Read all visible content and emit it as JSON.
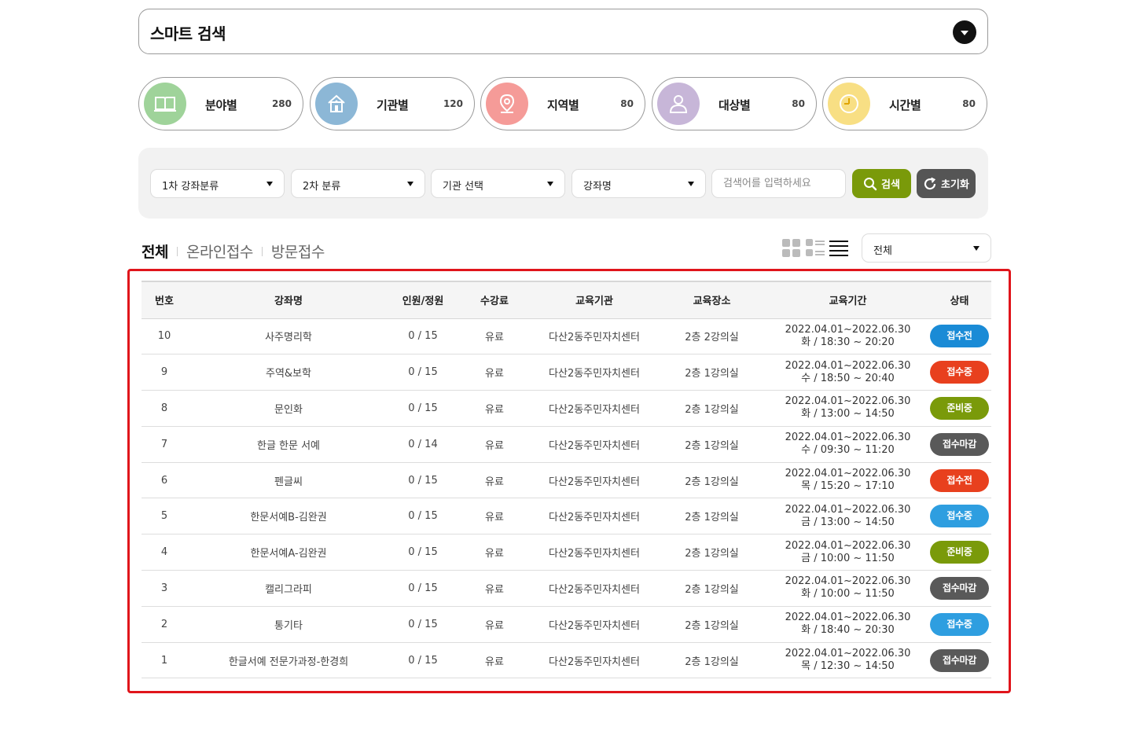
{
  "smart_search": {
    "title": "스마트 검색"
  },
  "categories": [
    {
      "label": "분야별",
      "count": "280",
      "icon": "book-icon",
      "color": "#9fd39a"
    },
    {
      "label": "기관별",
      "count": "120",
      "icon": "house-icon",
      "color": "#8cb7d6"
    },
    {
      "label": "지역별",
      "count": "80",
      "icon": "map-pin-icon",
      "color": "#f59b98"
    },
    {
      "label": "대상별",
      "count": "80",
      "icon": "person-icon",
      "color": "#c7b6d8"
    },
    {
      "label": "시간별",
      "count": "80",
      "icon": "clock-icon",
      "color": "#f8df84"
    }
  ],
  "filters": {
    "category1": "1차 강좌분류",
    "category2": "2차 분류",
    "institution": "기관 선택",
    "course": "강좌명",
    "keyword_placeholder": "검색어를 입력하세요",
    "search_label": "검색",
    "reset_label": "초기화"
  },
  "tabs": [
    {
      "label": "전체",
      "active": true
    },
    {
      "label": "온라인접수",
      "active": false
    },
    {
      "label": "방문접수",
      "active": false
    }
  ],
  "sort": {
    "value": "전체"
  },
  "table": {
    "headers": [
      "번호",
      "강좌명",
      "인원/정원",
      "수강료",
      "교육기관",
      "교육장소",
      "교육기간",
      "상태"
    ],
    "rows": [
      {
        "no": "10",
        "name": "사주명리학",
        "capacity": "0 / 15",
        "fee": "유료",
        "org": "다산2동주민자치센터",
        "place": "2층 2강의실",
        "period": "2022.04.01~2022.06.30",
        "time": "화 / 18:30 ~ 20:20",
        "status": "접수전",
        "status_color": "#1a8bd6"
      },
      {
        "no": "9",
        "name": "주역&보학",
        "capacity": "0 / 15",
        "fee": "유료",
        "org": "다산2동주민자치센터",
        "place": "2층 1강의실",
        "period": "2022.04.01~2022.06.30",
        "time": "수 / 18:50 ~ 20:40",
        "status": "접수중",
        "status_color": "#e8401e"
      },
      {
        "no": "8",
        "name": "문인화",
        "capacity": "0 / 15",
        "fee": "유료",
        "org": "다산2동주민자치센터",
        "place": "2층 1강의실",
        "period": "2022.04.01~2022.06.30",
        "time": "화 / 13:00 ~ 14:50",
        "status": "준비중",
        "status_color": "#7a9a0a"
      },
      {
        "no": "7",
        "name": "한글 한문 서예",
        "capacity": "0 / 14",
        "fee": "유료",
        "org": "다산2동주민자치센터",
        "place": "2층 1강의실",
        "period": "2022.04.01~2022.06.30",
        "time": "수 / 09:30 ~ 11:20",
        "status": "접수마감",
        "status_color": "#595959"
      },
      {
        "no": "6",
        "name": "펜글씨",
        "capacity": "0 / 15",
        "fee": "유료",
        "org": "다산2동주민자치센터",
        "place": "2층 1강의실",
        "period": "2022.04.01~2022.06.30",
        "time": "목 / 15:20 ~ 17:10",
        "status": "접수전",
        "status_color": "#e8401e"
      },
      {
        "no": "5",
        "name": "한문서예B-김완권",
        "capacity": "0 / 15",
        "fee": "유료",
        "org": "다산2동주민자치센터",
        "place": "2층 1강의실",
        "period": "2022.04.01~2022.06.30",
        "time": "금 / 13:00 ~ 14:50",
        "status": "접수중",
        "status_color": "#2e9ee0"
      },
      {
        "no": "4",
        "name": "한문서예A-김완권",
        "capacity": "0 / 15",
        "fee": "유료",
        "org": "다산2동주민자치센터",
        "place": "2층 1강의실",
        "period": "2022.04.01~2022.06.30",
        "time": "금 / 10:00 ~ 11:50",
        "status": "준비중",
        "status_color": "#7a9a0a"
      },
      {
        "no": "3",
        "name": "캘리그라피",
        "capacity": "0 / 15",
        "fee": "유료",
        "org": "다산2동주민자치센터",
        "place": "2층 1강의실",
        "period": "2022.04.01~2022.06.30",
        "time": "화 / 10:00 ~ 11:50",
        "status": "접수마감",
        "status_color": "#595959"
      },
      {
        "no": "2",
        "name": "통기타",
        "capacity": "0 / 15",
        "fee": "유료",
        "org": "다산2동주민자치센터",
        "place": "2층 1강의실",
        "period": "2022.04.01~2022.06.30",
        "time": "화 / 18:40 ~ 20:30",
        "status": "접수중",
        "status_color": "#2e9ee0"
      },
      {
        "no": "1",
        "name": "한글서예 전문가과정-한경희",
        "capacity": "0 / 15",
        "fee": "유료",
        "org": "다산2동주민자치센터",
        "place": "2층 1강의실",
        "period": "2022.04.01~2022.06.30",
        "time": "목 / 12:30 ~ 14:50",
        "status": "접수마감",
        "status_color": "#595959"
      }
    ]
  },
  "colors": {
    "highlight": "#e0151b",
    "search_button": "#7a9a0a",
    "reset_button": "#555555"
  }
}
